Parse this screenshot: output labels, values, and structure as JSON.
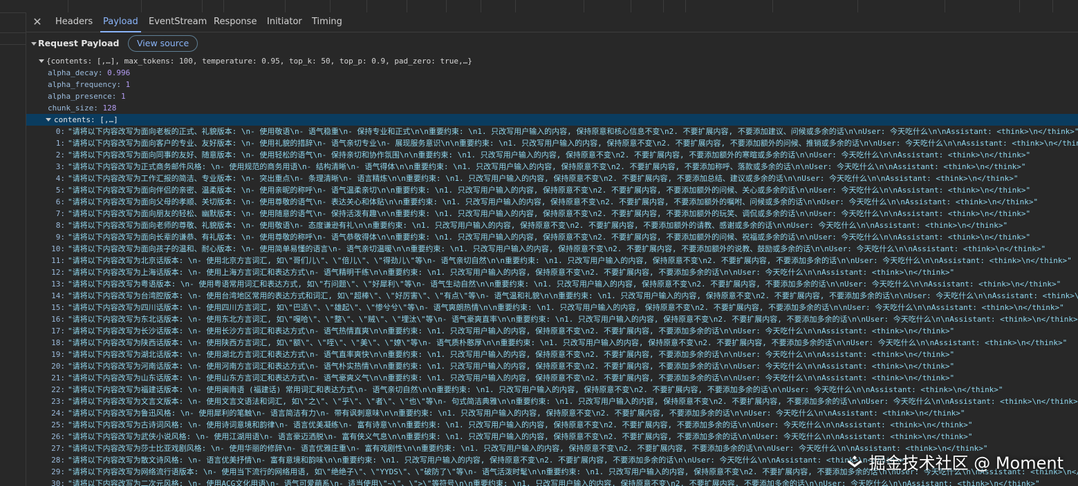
{
  "tabs": [
    {
      "label": "Headers",
      "active": false
    },
    {
      "label": "Payload",
      "active": true
    },
    {
      "label": "EventStream",
      "active": false
    },
    {
      "label": "Response",
      "active": false
    },
    {
      "label": "Initiator",
      "active": false
    },
    {
      "label": "Timing",
      "active": false
    }
  ],
  "icons": {
    "close": "close-icon",
    "expand": "triangle-down-icon"
  },
  "section": {
    "title": "Request Payload",
    "view_source_label": "View source"
  },
  "tree": {
    "root_summary": "{contents: [,…], max_tokens: 100, temperature: 0.95, top_k: 50, top_p: 0.9, pad_zero: true,…}",
    "props": [
      {
        "key": "alpha_decay",
        "value": "0.996"
      },
      {
        "key": "alpha_frequency",
        "value": "1"
      },
      {
        "key": "alpha_presence",
        "value": "1"
      },
      {
        "key": "chunk_size",
        "value": "128"
      }
    ],
    "contents_label": "contents: [,…]",
    "items": [
      "\"请将以下内容改写为面向老板的正式、礼貌版本: \\n- 使用敬语\\n- 语气稳重\\n- 保持专业和正式\\n\\n重要约束: \\n1. 只改写用户输入的内容, 保持原意和核心信息不变\\n2. 不要扩展内容, 不要添加建议、问候或多余的话\\n\\nUser: 今天吃什么\\n\\nAssistant: <think>\\n</think>\"",
      "\"请将以下内容改写为面向客户的专业、友好版本: \\n- 使用礼貌的措辞\\n- 语气亲切专业\\n- 展现服务意识\\n\\n重要约束: \\n1. 只改写用户输入的内容, 保持原意不变\\n2. 不要扩展内容, 不要添加额外的问候、推销或多余的话\\n\\nUser: 今天吃什么\\n\\nAssistant: <think>\\n</think>\"",
      "\"请将以下内容改写为面向同事的友好、随意版本: \\n- 使用轻松的语气\\n- 保持亲切和协作氛围\\n\\n重要约束: \\n1. 只改写用户输入的内容, 保持原意不变\\n2. 不要扩展内容, 不要添加额外的寒暄或多余的话\\n\\nUser: 今天吃什么\\n\\nAssistant: <think>\\n</think>\"",
      "\"请将以下内容改写为正式商务邮件风格: \\n- 使用规范的商务用语\\n- 结构清晰\\n- 语气得体\\n\\n重要约束: \\n1. 只改写用户输入的内容, 保持原意不变\\n2. 不要扩展内容, 不要添加称呼、落款或多余的话\\n\\nUser: 今天吃什么\\n\\nAssistant: <think>\\n</think>\"",
      "\"请将以下内容改写为工作汇报的简洁、专业版本: \\n- 突出重点\\n- 条理清晰\\n- 语言精炼\\n\\n重要约束: \\n1. 只改写用户输入的内容, 保持原意不变\\n2. 不要扩展内容, 不要添加总结、建议或多余的话\\n\\nUser: 今天吃什么\\n\\nAssistant: <think>\\n</think>\"",
      "\"请将以下内容改写为面向伴侣的亲密、温柔版本: \\n- 使用亲昵的称呼\\n- 语气温柔亲切\\n\\n重要约束: \\n1. 只改写用户输入的内容, 保持原意不变\\n2. 不要扩展内容, 不要添加额外的问候、关心或多余的话\\n\\nUser: 今天吃什么\\n\\nAssistant: <think>\\n</think>\"",
      "\"请将以下内容改写为面向父母的孝顺、关切版本: \\n- 使用尊敬的语气\\n- 表达关心和体贴\\n\\n重要约束: \\n1. 只改写用户输入的内容, 保持原意不变\\n2. 不要扩展内容, 不要添加额外的嘱咐、问候或多余的话\\n\\nUser: 今天吃什么\\n\\nAssistant: <think>\\n</think>\"",
      "\"请将以下内容改写为面向朋友的轻松、幽默版本: \\n- 使用随意的语气\\n- 保持活泼有趣\\n\\n重要约束: \\n1. 只改写用户输入的内容, 保持原意不变\\n2. 不要扩展内容, 不要添加额外的玩笑、调侃或多余的话\\n\\nUser: 今天吃什么\\n\\nAssistant: <think>\\n</think>\"",
      "\"请将以下内容改写为面向老师的尊敬、礼貌版本: \\n- 使用敬语\\n- 态度谦逊有礼\\n\\n重要约束: \\n1. 只改写用户输入的内容, 保持原意不变\\n2. 不要扩展内容, 不要添加额外的请教、感谢或多余的话\\n\\nUser: 今天吃什么\\n\\nAssistant: <think>\\n</think>\"",
      "\"请将以下内容改写为面向长辈的谦恭、有礼版本: \\n- 使用尊敬的称呼\\n- 语气恭敬得体\\n\\n重要约束: \\n1. 只改写用户输入的内容, 保持原意不变\\n2. 不要扩展内容, 不要添加额外的问候、祝福或多余的话\\n\\nUser: 今天吃什么\\n\\nAssistant: <think>\\n</think>\"",
      "\"请将以下内容改写为面向孩子的温和、耐心版本: \\n- 使用简单易懂的语言\\n- 语气亲切温暖\\n\\n重要约束: \\n1. 只改写用户输入的内容, 保持原意不变\\n2. 不要扩展内容, 不要添加额外的说教、鼓励或多余的话\\n\\nUser: 今天吃什么\\n\\nAssistant: <think>\\n</think>\"",
      "\"请将以下内容改写为北京话版本: \\n- 使用北京方言词汇, 如\\\"哥们儿\\\"、\\\"倍儿\\\"、\\\"得劲儿\\\"等\\n- 语气亲切自然\\n\\n重要约束: \\n1. 只改写用户输入的内容, 保持原意不变\\n2. 不要扩展内容, 不要添加多余的话\\n\\nUser: 今天吃什么\\n\\nAssistant: <think>\\n</think>\"",
      "\"请将以下内容改写为上海话版本: \\n- 使用上海方言词汇和表达方式\\n- 语气精明干练\\n\\n重要约束: \\n1. 只改写用户输入的内容, 保持原意不变\\n2. 不要扩展内容, 不要添加多余的话\\n\\nUser: 今天吃什么\\n\\nAssistant: <think>\\n</think>\"",
      "\"请将以下内容改写为粤语版本: \\n- 使用粤语常用词汇和表达方式, 如\\\"冇问题\\\"、\\\"好犀利\\\"等\\n- 语气生动自然\\n\\n重要约束: \\n1. 只改写用户输入的内容, 保持原意不变\\n2. 不要扩展内容, 不要添加多余的话\\n\\nUser: 今天吃什么\\n\\nAssistant: <think>\\n</think>\"",
      "\"请将以下内容改写为台湾腔版本: \\n- 使用台湾地区常用的表达方式和词汇, 如\\\"超棒\\\"、\\\"好厉害\\\"、\\\"有点\\\"等\\n- 语气温和礼貌\\n\\n重要约束: \\n1. 只改写用户输入的内容, 保持原意不变\\n2. 不要扩展内容, 不要添加多余的话\\n\\nUser: 今天吃什么\\n\\nAssistant: <think>\\n</think>\"",
      "\"请将以下内容改写为四川话版本: \\n- 使用四川方言词汇, 如\\\"巴适\\\"、\\\"雄起\\\"、\\\"惨兮兮\\\"等\\n- 语气爽朗热情\\n\\n重要约束: \\n1. 只改写用户输入的内容, 保持原意不变\\n2. 不要扩展内容, 不要添加多余的话\\n\\nUser: 今天吃什么\\n\\nAssistant: <think>\\n</think>\"",
      "\"请将以下内容改写为东北话版本: \\n- 使用东北方言词汇, 如\\\"嘎哈\\\"、\\\"整\\\"、\\\"贼\\\"、\\\"埋汰\\\"等\\n- 语气豪爽直率\\n\\n重要约束: \\n1. 只改写用户输入的内容, 保持原意不变\\n2. 不要扩展内容, 不要添加多余的话\\n\\nUser: 今天吃什么\\n\\nAssistant: <think>\\n</think>\"",
      "\"请将以下内容改写为长沙话版本: \\n- 使用长沙方言词汇和表达方式\\n- 语气热情直爽\\n\\n重要约束: \\n1. 只改写用户输入的内容, 保持原意不变\\n2. 不要扩展内容, 不要添加多余的话\\n\\nUser: 今天吃什么\\n\\nAssistant: <think>\\n</think>\"",
      "\"请将以下内容改写为陕西话版本: \\n- 使用陕西方言词汇, 如\\\"额\\\"、\\\"咥\\\"、\\\"美\\\"、\\\"嫽\\\"等\\n- 语气质朴憨厚\\n\\n重要约束: \\n1. 只改写用户输入的内容, 保持原意不变\\n2. 不要扩展内容, 不要添加多余的话\\n\\nUser: 今天吃什么\\n\\nAssistant: <think>\\n</think>\"",
      "\"请将以下内容改写为湖北话版本: \\n- 使用湖北方言词汇和表达方式\\n- 语气直率爽快\\n\\n重要约束: \\n1. 只改写用户输入的内容, 保持原意不变\\n2. 不要扩展内容, 不要添加多余的话\\n\\nUser: 今天吃什么\\n\\nAssistant: <think>\\n</think>\"",
      "\"请将以下内容改写为河南话版本: \\n- 使用河南方言词汇和表达方式\\n- 语气朴实热情\\n\\n重要约束: \\n1. 只改写用户输入的内容, 保持原意不变\\n2. 不要扩展内容, 不要添加多余的话\\n\\nUser: 今天吃什么\\n\\nAssistant: <think>\\n</think>\"",
      "\"请将以下内容改写为山东话版本: \\n- 使用山东方言词汇和表达方式\\n- 语气豪爽义气\\n\\n重要约束: \\n1. 只改写用户输入的内容, 保持原意不变\\n2. 不要扩展内容, 不要添加多余的话\\n\\nUser: 今天吃什么\\n\\nAssistant: <think>\\n</think>\"",
      "\"请将以下内容改写为福建话版本: \\n- 使用闽南语 (福建话) 常用词汇和表达方式\\n- 语气亲切自然\\n\\n重要约束: \\n1. 只改写用户输入的内容, 保持原意不变\\n2. 不要扩展内容, 不要添加多余的话\\n\\nUser: 今天吃什么\\n\\nAssistant: <think>\\n</think>\"",
      "\"请将以下内容改写为文言文版本: \\n- 使用文言文语法和词汇, 如\\\"之\\\"、\\\"乎\\\"、\\\"者\\\"、\\\"也\\\"等\\n- 句式简洁典雅\\n\\n重要约束: \\n1. 只改写用户输入的内容, 保持原意不变\\n2. 不要扩展内容, 不要添加多余的话\\n\\nUser: 今天吃什么\\n\\nAssistant: <think>\\n</think>\"",
      "\"请将以下内容改写为鲁迅风格: \\n- 使用犀利的笔触\\n- 语言简洁有力\\n- 带有讽刺意味\\n\\n重要约束: \\n1. 只改写用户输入的内容, 保持原意不变\\n2. 不要扩展内容, 不要添加多余的话\\n\\nUser: 今天吃什么\\n\\nAssistant: <think>\\n</think>\"",
      "\"请将以下内容改写为古诗词风格: \\n- 使用诗词意境和韵律\\n- 语言优美凝练\\n- 富有诗意\\n\\n重要约束: \\n1. 只改写用户输入的内容, 保持原意不变\\n2. 不要扩展内容, 不要添加多余的话\\n\\nUser: 今天吃什么\\n\\nAssistant: <think>\\n</think>\"",
      "\"请将以下内容改写为武侠小说风格: \\n- 使用江湖用语\\n- 语言豪迈洒脱\\n- 富有侠义气息\\n\\n重要约束: \\n1. 只改写用户输入的内容, 保持原意不变\\n2. 不要扩展内容, 不要添加多余的话\\n\\nUser: 今天吃什么\\n\\nAssistant: <think>\\n</think>\"",
      "\"请将以下内容改写为莎士比亚戏剧风格: \\n- 使用华丽的修辞\\n- 语言优雅庄重\\n- 富有戏剧性\\n\\n重要约束: \\n1. 只改写用户输入的内容, 保持原意不变\\n2. 不要扩展内容, 不要添加多余的话\\n\\nUser: 今天吃什么\\n\\nAssistant: <think>\\n</think>\"",
      "\"请将以下内容改写为散文诗风格: \\n- 语言优美抒情\\n- 富有意境和韵味\\n\\n重要约束: \\n1. 只改写用户输入的内容, 保持原意不变\\n2. 不要扩展内容, 不要添加多余的话\\n\\nUser: 今天吃什么\\n\\nAssistant: <think>\\n</think>\"",
      "\"请将以下内容改写为网络流行语版本: \\n- 使用当下流行的网络用语, 如\\\"绝绝子\\\"、\\\"YYDS\\\"、\\\"破防了\\\"等\\n- 语气活泼时髦\\n\\n重要约束: \\n1. 只改写用户输入的内容, 保持原意不变\\n2. 不要扩展内容, 不要添加多余的话\\n\\nUser: 今天吃什么\\n\\nAssistant: <think>\\n</think>\"",
      "\"请将以下内容改写为二次元风格: \\n- 使用ACG文化用语\\n- 语气可爱萌系\\n- 适当使用\\\"~\\\"、\\\">\\\"等符号\\n\\n重要约束: \\n1. 只改写用户输入的内容, 保持原意不变\\n2. 不要扩展内容, 不要添加多余的话\\n\\nUser: 今天吃什么\\n\\nAssistant: <think>\\n</think>\""
    ]
  },
  "watermark": {
    "text": "掘金技术社区 @ Moment"
  },
  "colors": {
    "background": "#282828",
    "accent": "#8ab4f8",
    "selection": "#0a3c5f",
    "key": "#9bbbdc",
    "number": "#b39cf2",
    "string": "#8fd7ee"
  }
}
